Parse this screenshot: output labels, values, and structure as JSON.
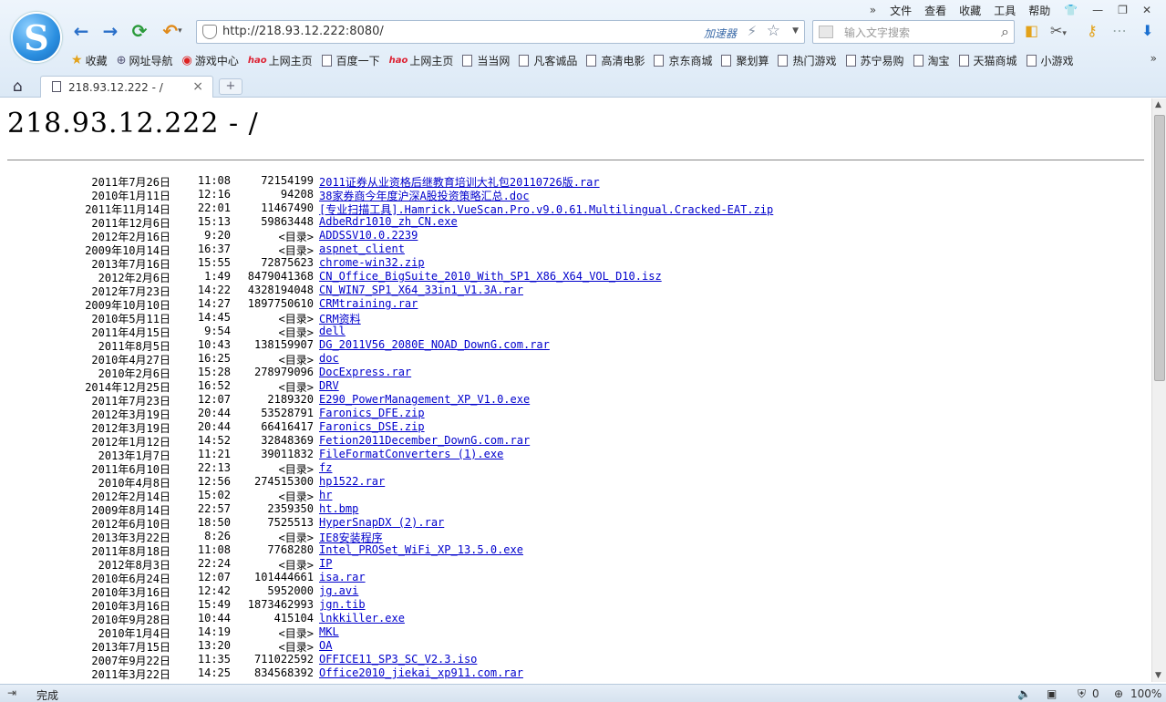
{
  "menu": {
    "items": [
      "文件",
      "查看",
      "收藏",
      "工具",
      "帮助"
    ]
  },
  "address": {
    "url": "http://218.93.12.222:8080/",
    "accelerator": "加速器"
  },
  "search": {
    "placeholder": "输入文字搜索"
  },
  "favorites": [
    {
      "label": "收藏",
      "icon": "star-icon"
    },
    {
      "label": "网址导航",
      "icon": "globe-icon"
    },
    {
      "label": "游戏中心",
      "icon": "game-icon"
    },
    {
      "label": "上网主页",
      "icon": "hao-icon"
    },
    {
      "label": "百度一下",
      "icon": "page-icon"
    },
    {
      "label": "上网主页",
      "icon": "hao-icon"
    },
    {
      "label": "当当网",
      "icon": "page-icon"
    },
    {
      "label": "凡客诚品",
      "icon": "page-icon"
    },
    {
      "label": "高清电影",
      "icon": "page-icon"
    },
    {
      "label": "京东商城",
      "icon": "page-icon"
    },
    {
      "label": "聚划算",
      "icon": "page-icon"
    },
    {
      "label": "热门游戏",
      "icon": "page-icon"
    },
    {
      "label": "苏宁易购",
      "icon": "page-icon"
    },
    {
      "label": "淘宝",
      "icon": "page-icon"
    },
    {
      "label": "天猫商城",
      "icon": "page-icon"
    },
    {
      "label": "小游戏",
      "icon": "page-icon"
    }
  ],
  "tab": {
    "title": "218.93.12.222 - /"
  },
  "page": {
    "heading": "218.93.12.222 - /"
  },
  "listing": [
    {
      "date": "2011年7月26日",
      "time": "11:08",
      "size": "72154199",
      "name": "2011证券从业资格后继教育培训大礼包20110726版.rar"
    },
    {
      "date": "2010年1月11日",
      "time": "12:16",
      "size": "94208",
      "name": "38家券商今年度沪深A股投资策略汇总.doc"
    },
    {
      "date": "2011年11月14日",
      "time": "22:01",
      "size": "11467490",
      "name": "[专业扫描工具].Hamrick.VueScan.Pro.v9.0.61.Multilingual.Cracked-EAT.zip"
    },
    {
      "date": "2011年12月6日",
      "time": "15:13",
      "size": "59863448",
      "name": "AdbeRdr1010_zh_CN.exe"
    },
    {
      "date": "2012年2月16日",
      "time": "9:20",
      "size": "<目录>",
      "name": "ADDSSV10.0.2239"
    },
    {
      "date": "2009年10月14日",
      "time": "16:37",
      "size": "<目录>",
      "name": "aspnet_client"
    },
    {
      "date": "2013年7月16日",
      "time": "15:55",
      "size": "72875623",
      "name": "chrome-win32.zip"
    },
    {
      "date": "2012年2月6日",
      "time": "1:49",
      "size": "8479041368",
      "name": "CN_Office_BigSuite_2010_With_SP1_X86_X64_VOL_D10.isz"
    },
    {
      "date": "2012年7月23日",
      "time": "14:22",
      "size": "4328194048",
      "name": "CN_WIN7_SP1_X64_33in1_V1.3A.rar"
    },
    {
      "date": "2009年10月10日",
      "time": "14:27",
      "size": "1897750610",
      "name": "CRMtraining.rar"
    },
    {
      "date": "2010年5月11日",
      "time": "14:45",
      "size": "<目录>",
      "name": "CRM资料"
    },
    {
      "date": "2011年4月15日",
      "time": "9:54",
      "size": "<目录>",
      "name": "dell"
    },
    {
      "date": "2011年8月5日",
      "time": "10:43",
      "size": "138159907",
      "name": "DG_2011V56_2080E_NOAD_DownG.com.rar"
    },
    {
      "date": "2010年4月27日",
      "time": "16:25",
      "size": "<目录>",
      "name": "doc"
    },
    {
      "date": "2010年2月6日",
      "time": "15:28",
      "size": "278979096",
      "name": "DocExpress.rar"
    },
    {
      "date": "2014年12月25日",
      "time": "16:52",
      "size": "<目录>",
      "name": "DRV"
    },
    {
      "date": "2011年7月23日",
      "time": "12:07",
      "size": "2189320",
      "name": "E290_PowerManagement_XP_V1.0.exe"
    },
    {
      "date": "2012年3月19日",
      "time": "20:44",
      "size": "53528791",
      "name": "Faronics_DFE.zip"
    },
    {
      "date": "2012年3月19日",
      "time": "20:44",
      "size": "66416417",
      "name": "Faronics_DSE.zip"
    },
    {
      "date": "2012年1月12日",
      "time": "14:52",
      "size": "32848369",
      "name": "Fetion2011December_DownG.com.rar"
    },
    {
      "date": "2013年1月7日",
      "time": "11:21",
      "size": "39011832",
      "name": "FileFormatConverters (1).exe"
    },
    {
      "date": "2011年6月10日",
      "time": "22:13",
      "size": "<目录>",
      "name": "fz"
    },
    {
      "date": "2010年4月8日",
      "time": "12:56",
      "size": "274515300",
      "name": "hp1522.rar"
    },
    {
      "date": "2012年2月14日",
      "time": "15:02",
      "size": "<目录>",
      "name": "hr"
    },
    {
      "date": "2009年8月14日",
      "time": "22:57",
      "size": "2359350",
      "name": "ht.bmp"
    },
    {
      "date": "2012年6月10日",
      "time": "18:50",
      "size": "7525513",
      "name": "HyperSnapDX (2).rar"
    },
    {
      "date": "2013年3月22日",
      "time": "8:26",
      "size": "<目录>",
      "name": "IE8安装程序"
    },
    {
      "date": "2011年8月18日",
      "time": "11:08",
      "size": "7768280",
      "name": "Intel_PROSet_WiFi_XP_13.5.0.exe"
    },
    {
      "date": "2012年8月3日",
      "time": "22:24",
      "size": "<目录>",
      "name": "IP"
    },
    {
      "date": "2010年6月24日",
      "time": "12:07",
      "size": "101444661",
      "name": "isa.rar"
    },
    {
      "date": "2010年3月16日",
      "time": "12:42",
      "size": "5952000",
      "name": "jg.avi"
    },
    {
      "date": "2010年3月16日",
      "time": "15:49",
      "size": "1873462993",
      "name": "jgn.tib"
    },
    {
      "date": "2010年9月28日",
      "time": "10:44",
      "size": "415104",
      "name": "lnkkiller.exe"
    },
    {
      "date": "2010年1月4日",
      "time": "14:19",
      "size": "<目录>",
      "name": "MKL"
    },
    {
      "date": "2013年7月15日",
      "time": "13:20",
      "size": "<目录>",
      "name": "OA"
    },
    {
      "date": "2007年9月22日",
      "time": "11:35",
      "size": "711022592",
      "name": "OFFICE11_SP3_SC_V2.3.iso"
    },
    {
      "date": "2011年3月22日",
      "time": "14:25",
      "size": "834568392",
      "name": "Office2010_jiekai_xp911.com.rar"
    }
  ],
  "status": {
    "text": "完成",
    "zoom": "100%",
    "count": "0"
  }
}
